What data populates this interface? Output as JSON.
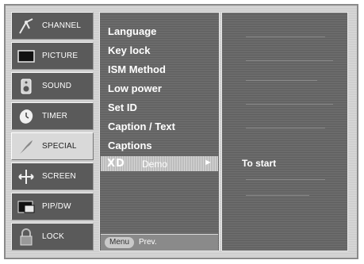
{
  "sidebar": {
    "items": [
      {
        "label": "CHANNEL",
        "icon": "antenna-icon",
        "selected": false
      },
      {
        "label": "PICTURE",
        "icon": "tv-screen-icon",
        "selected": false
      },
      {
        "label": "SOUND",
        "icon": "speaker-icon",
        "selected": false
      },
      {
        "label": "TIMER",
        "icon": "clock-icon",
        "selected": false
      },
      {
        "label": "SPECIAL",
        "icon": "special-icon",
        "selected": true
      },
      {
        "label": "SCREEN",
        "icon": "crosshair-icon",
        "selected": false
      },
      {
        "label": "PIP/DW",
        "icon": "pip-icon",
        "selected": false
      },
      {
        "label": "LOCK",
        "icon": "padlock-icon",
        "selected": false
      }
    ]
  },
  "menu": {
    "items": [
      "Language",
      "Key lock",
      "ISM Method",
      "Low power",
      "Set ID",
      "Caption / Text",
      "Captions"
    ],
    "selected_logo": "XD",
    "selected_label": "Demo",
    "selected_arrow": "►",
    "bottom": {
      "menu_label": "Menu",
      "prev_label": "Prev."
    }
  },
  "submenu": {
    "item": "To start"
  },
  "colors": {
    "panel": "#6b6b6b",
    "selected_row": "#bdbdbd",
    "frame": "#cfcfcf"
  }
}
